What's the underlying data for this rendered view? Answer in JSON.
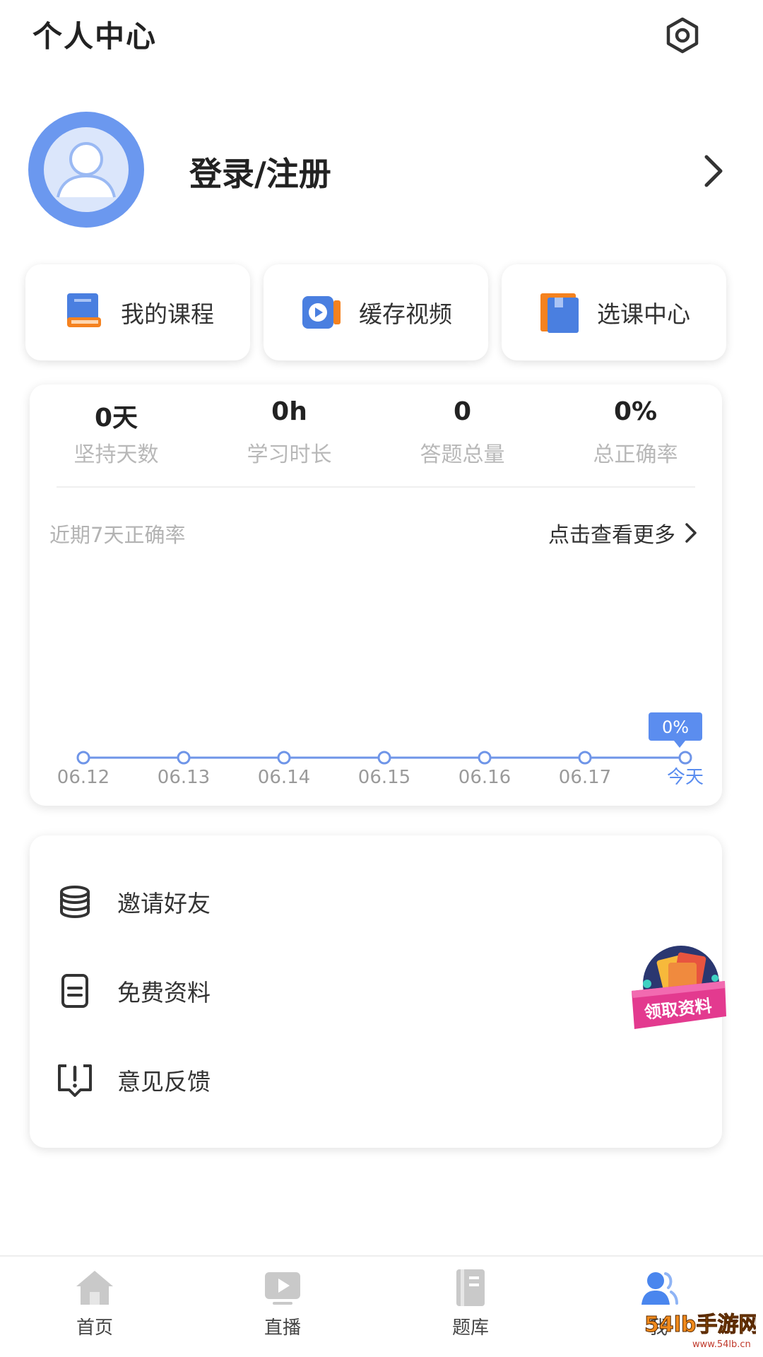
{
  "header": {
    "title": "个人中心"
  },
  "profile": {
    "login_label": "登录/注册"
  },
  "quick_actions": [
    {
      "label": "我的课程",
      "icon": "course-book-icon"
    },
    {
      "label": "缓存视频",
      "icon": "video-cache-icon"
    },
    {
      "label": "选课中心",
      "icon": "course-select-icon"
    }
  ],
  "stats": [
    {
      "value": "0天",
      "label": "坚持天数"
    },
    {
      "value": "0h",
      "label": "学习时长"
    },
    {
      "value": "0",
      "label": "答题总量"
    },
    {
      "value": "0%",
      "label": "总正确率"
    }
  ],
  "chart": {
    "title": "近期7天正确率",
    "more_label": "点击查看更多"
  },
  "chart_data": {
    "type": "line",
    "categories": [
      "06.12",
      "06.13",
      "06.14",
      "06.15",
      "06.16",
      "06.17",
      "今天"
    ],
    "values": [
      0,
      0,
      0,
      0,
      0,
      0,
      0
    ],
    "highlight": {
      "index": 6,
      "label": "0%"
    },
    "title": "近期7天正确率",
    "xlabel": "",
    "ylabel": "",
    "colors": {
      "line": "#6f95e8",
      "highlight": "#5b8def"
    }
  },
  "menu": [
    {
      "label": "邀请好友",
      "icon": "coins-stack-icon"
    },
    {
      "label": "免费资料",
      "icon": "document-icon"
    },
    {
      "label": "意见反馈",
      "icon": "feedback-icon"
    }
  ],
  "promo": {
    "label": "领取资料"
  },
  "tabbar": [
    {
      "label": "首页",
      "icon": "home-icon"
    },
    {
      "label": "直播",
      "icon": "live-play-icon"
    },
    {
      "label": "题库",
      "icon": "question-bank-icon"
    },
    {
      "label": "我",
      "icon": "profile-icon"
    }
  ],
  "watermark": {
    "text": "54lb手游网",
    "sub": "www.54lb.cn"
  },
  "colors": {
    "accent": "#5b8def",
    "avatar": "#6b98ef",
    "orange": "#f5821f"
  }
}
